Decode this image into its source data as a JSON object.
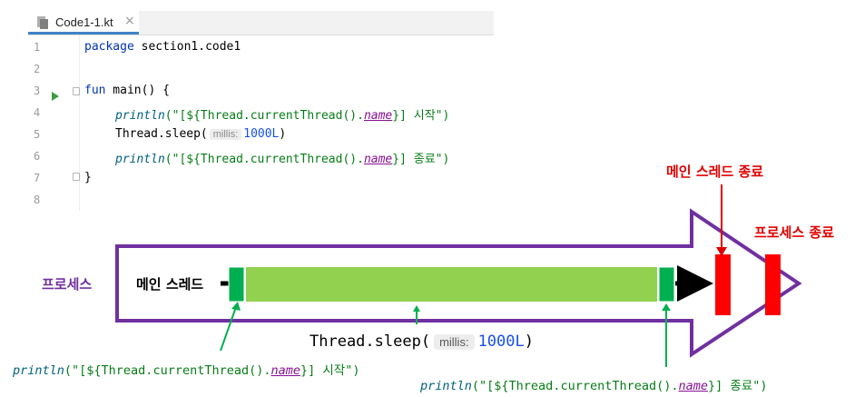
{
  "editor": {
    "tab_label": "Code1-1.kt",
    "tab_close": "×",
    "line_numbers": [
      "1",
      "2",
      "3",
      "4",
      "5",
      "6",
      "7",
      "8"
    ],
    "lines": {
      "l1_kw": "package",
      "l1_rest": " section1.code1",
      "l3_kw": "fun",
      "l3_rest": " main() {",
      "l4_fn": "println",
      "l4_str_a": "(\"[${Thread.currentThread().",
      "l4_prop": "name",
      "l4_str_b": "}] 시작\")",
      "l5_a": "Thread.sleep(",
      "l5_hint": "millis:",
      "l5_num": "1000L",
      "l5_b": ")",
      "l6_fn": "println",
      "l6_str_a": "(\"[${Thread.currentThread().",
      "l6_prop": "name",
      "l6_str_b": "}] 종료\")",
      "l7": "}"
    }
  },
  "diagram": {
    "process_label": "프로세스",
    "main_thread_label": "메인 스레드",
    "main_thread_end_label": "메인 스레드 종료",
    "process_end_label": "프로세스 종료",
    "sleep_label": {
      "prefix": "Thread.sleep(",
      "hint": "millis:",
      "value": "1000L",
      "suffix": ")"
    },
    "print_start": {
      "fn": "println",
      "text_a": "(\"[${Thread.currentThread().",
      "prop": "name",
      "text_b": "}] 시작\")"
    },
    "print_end": {
      "fn": "println",
      "text_a": "(\"[${Thread.currentThread().",
      "prop": "name",
      "text_b": "}] 종료\")"
    },
    "colors": {
      "process_outline": "#7030a0",
      "sleep_bar": "#92d050",
      "print_block": "#00b050",
      "end_marker": "#ff0000",
      "thread_line": "#000000",
      "pointer_green": "#00b050",
      "pointer_red": "#e00000"
    }
  }
}
